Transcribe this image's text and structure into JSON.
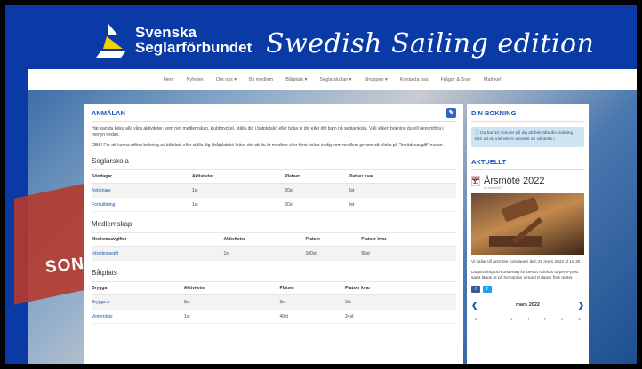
{
  "brand": {
    "line1": "Svenska",
    "line2": "Seglarförbundet",
    "edition": "Swedish Sailing edition"
  },
  "nav": [
    "Hem",
    "Nyheter",
    "Om oss ▾",
    "Bli medlem",
    "Båtplats ▾",
    "Seglarskolan ▾",
    "Shoppen ▾",
    "Kontakta oss",
    "Frågor & Svar",
    "Matrikel"
  ],
  "background_text": "SON",
  "main": {
    "title": "ANMÄLAN",
    "intro1": "Här kan du boka alla våra aktiviteter, som nytt medlemskap, klubbnyckel, ställa dig i båtplatskö eller boka in dig eller ditt barn på seglarskola. Välj vilken bokning du vill genomföra i menyn nedan.",
    "intro2": "OBS! För att kunna utföra bokning av båtplats eller ställa dig i båtplatskö krävs det att du är medlem eller först bokar in dig som medlem genom att klicka på \"Inträdesavgift\" nedan.",
    "sections": [
      {
        "title": "Seglarskola",
        "headers": [
          "Söndagar",
          "Aktiviteter",
          "Platser",
          "Platser kvar"
        ],
        "rows": [
          [
            "Nybörjare",
            "1st",
            "20st",
            "8st"
          ],
          [
            "Fortsättning",
            "1st",
            "20st",
            "9st"
          ]
        ]
      },
      {
        "title": "Medlemskap",
        "headers": [
          "Medlemsavgifter",
          "Aktiviteter",
          "Platser",
          "Platser kvar"
        ],
        "rows": [
          [
            "Inträdesavgift",
            "1st",
            "100st",
            "95st"
          ]
        ]
      },
      {
        "title": "Båtplats",
        "headers": [
          "Brygga",
          "Aktiviteter",
          "Platser",
          "Platser kvar"
        ],
        "rows": [
          [
            "Brygga A",
            "3st",
            "3st",
            "2st"
          ],
          [
            "Vinterplats",
            "1st",
            "40st",
            "24st"
          ]
        ]
      }
    ]
  },
  "side": {
    "booking_title": "DIN BOKNING",
    "booking_info": "Du har 10 minuter på dig att bekräfta din bokning från att du valt vilken aktivitet du vill delta i.",
    "news_title": "AKTUELLT",
    "news": {
      "month": "MAR",
      "day": "31",
      "headline": "Årsmöte 2022",
      "date": "31 mar 2022",
      "text1": "Vi kallar till årsmöte torsdagen den 31 mars 2022 kl 18.30",
      "text2": "Dagordning och underlag för beslut skickas ut per e-post samt läggs ut på hemsidan senast 8 dagar före mötet."
    },
    "social": {
      "facebook": "f",
      "twitter": "t"
    },
    "calendar": {
      "month": "mars 2022",
      "days": [
        "M",
        "T",
        "O",
        "T",
        "F",
        "L",
        "S"
      ]
    }
  }
}
